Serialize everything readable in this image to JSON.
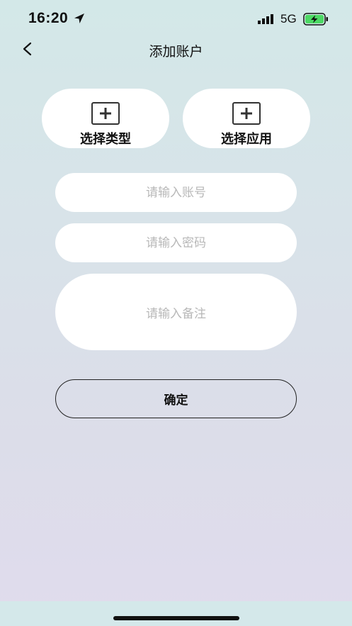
{
  "status_bar": {
    "time": "16:20",
    "network": "5G",
    "icons": [
      "location-arrow-icon",
      "signal-icon",
      "battery-charging-icon"
    ],
    "battery_color": "#4cd964"
  },
  "nav": {
    "back_icon": "chevron-left-icon",
    "title": "添加账户"
  },
  "pickers": {
    "type_label": "选择类型",
    "app_label": "选择应用",
    "icon": "plus-square-icon"
  },
  "form": {
    "account_placeholder": "请输入账号",
    "account_value": "",
    "password_placeholder": "请输入密码",
    "password_value": "",
    "note_placeholder": "请输入备注",
    "note_value": ""
  },
  "actions": {
    "confirm_label": "确定"
  },
  "colors": {
    "background_top": "#d3e8e8",
    "background_bottom": "#e0dced",
    "card": "#ffffff",
    "placeholder": "#b8b8b8"
  }
}
